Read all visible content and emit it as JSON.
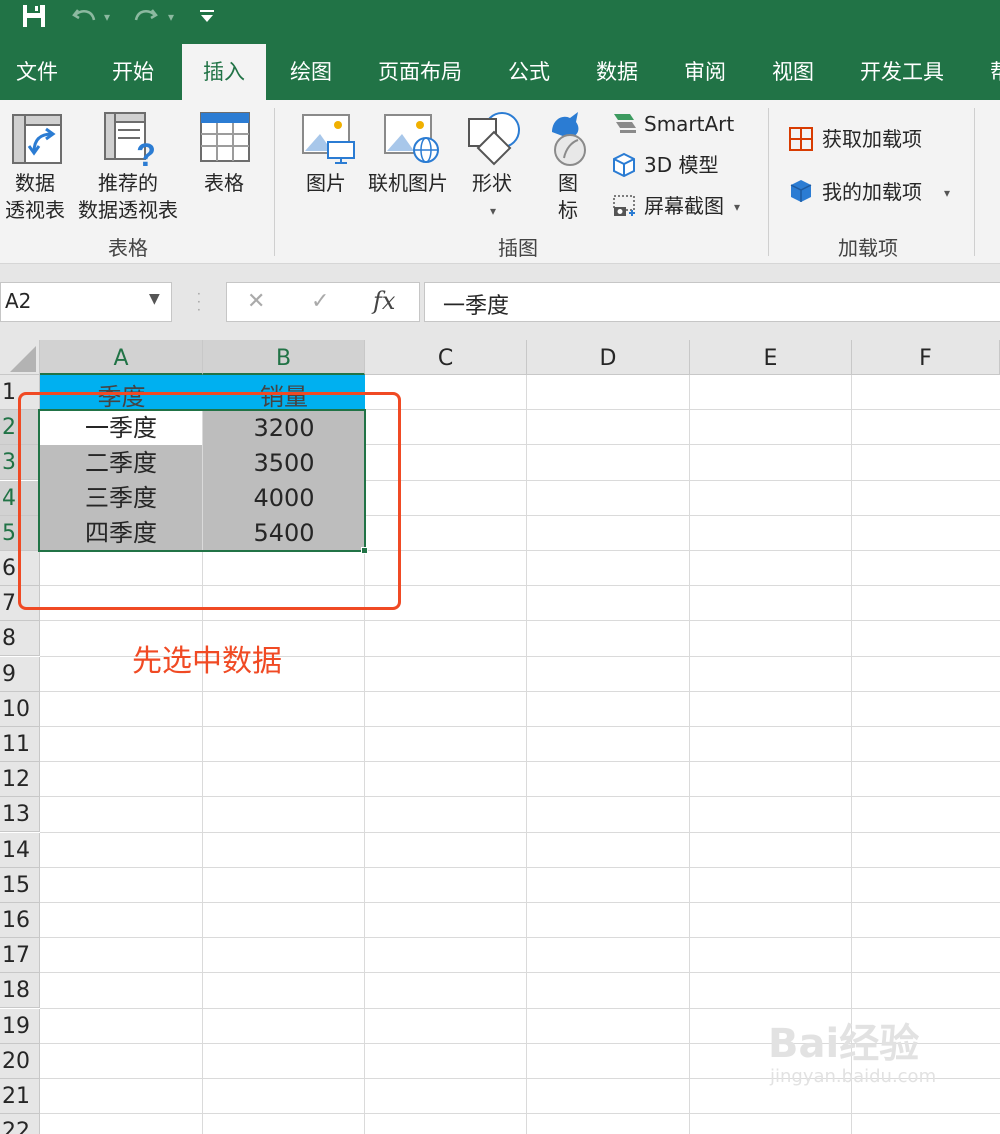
{
  "quick_access": {
    "save": "save-icon",
    "undo": "undo-icon",
    "redo": "redo-icon",
    "customize": "customize-icon"
  },
  "tabs": [
    "文件",
    "开始",
    "插入",
    "绘图",
    "页面布局",
    "公式",
    "数据",
    "审阅",
    "视图",
    "开发工具",
    "帮"
  ],
  "active_tab": "插入",
  "ribbon": {
    "tables_group": {
      "pivot_line1": "数据",
      "pivot_line2": "透视表",
      "recommended_line1": "推荐的",
      "recommended_line2": "数据透视表",
      "table": "表格",
      "label": "表格"
    },
    "illustrations_group": {
      "pictures": "图片",
      "online_pictures": "联机图片",
      "shapes": "形状",
      "icons_line1": "图",
      "icons_line2": "标",
      "smartart": "SmartArt",
      "model3d": "3D 模型",
      "screenshot": "屏幕截图",
      "label": "插图"
    },
    "addins_group": {
      "get_addins": "获取加载项",
      "my_addins": "我的加载项",
      "label": "加载项"
    }
  },
  "formula_bar": {
    "name_box": "A2",
    "cancel": "✕",
    "enter": "✓",
    "fx": "fx",
    "value": "一季度"
  },
  "columns": [
    "A",
    "B",
    "C",
    "D",
    "E",
    "F"
  ],
  "rows": [
    "1",
    "2",
    "3",
    "4",
    "5",
    "6",
    "7",
    "8",
    "9",
    "10",
    "11",
    "12",
    "13",
    "14",
    "15",
    "16",
    "17",
    "18",
    "19",
    "20",
    "21",
    "22"
  ],
  "sheet": {
    "header": [
      "季度",
      "销量"
    ],
    "data": [
      [
        "一季度",
        "3200"
      ],
      [
        "二季度",
        "3500"
      ],
      [
        "三季度",
        "4000"
      ],
      [
        "四季度",
        "5400"
      ]
    ]
  },
  "annotation": "先选中数据",
  "watermark": {
    "line1": "Bai经验",
    "line2": "jingyan.baidu.com"
  }
}
